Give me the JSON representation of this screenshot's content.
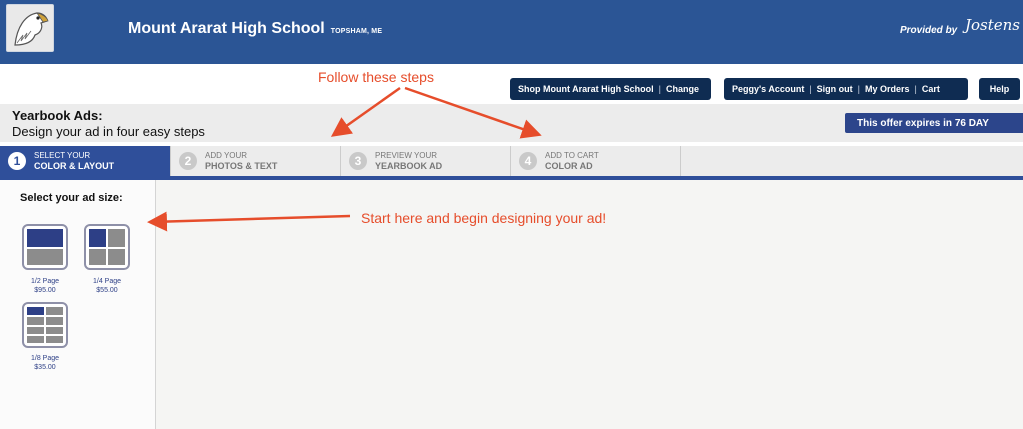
{
  "header": {
    "school_name": "Mount Ararat High School",
    "school_location": "TOPSHAM, ME",
    "provided_by": "Provided by",
    "provider_logo": "Jostens"
  },
  "topnav": {
    "shop_label": "Shop Mount Ararat High School",
    "change_label": "Change",
    "account_label": "Peggy's Account",
    "signout_label": "Sign out",
    "orders_label": "My Orders",
    "cart_label": "Cart",
    "help_label": "Help"
  },
  "annotations": {
    "follow_steps": "Follow these steps",
    "start_here": "Start here and begin designing your ad!"
  },
  "page": {
    "title": "Yearbook Ads:",
    "subtitle": "Design your ad in four easy steps",
    "offer_text": "This offer expires in",
    "offer_days": "76 DAY"
  },
  "steps": [
    {
      "num": "1",
      "line1": "SELECT YOUR",
      "line2": "COLOR & LAYOUT",
      "active": true
    },
    {
      "num": "2",
      "line1": "ADD YOUR",
      "line2": "PHOTOS & TEXT",
      "active": false
    },
    {
      "num": "3",
      "line1": "PREVIEW YOUR",
      "line2": "YEARBOOK AD",
      "active": false
    },
    {
      "num": "4",
      "line1": "ADD TO CART",
      "line2": "COLOR AD",
      "active": false
    }
  ],
  "sidebar": {
    "title": "Select your ad size:",
    "sizes": [
      {
        "name": "1/2 Page",
        "price": "$95.00"
      },
      {
        "name": "1/4 Page",
        "price": "$55.00"
      },
      {
        "name": "1/8 Page",
        "price": "$35.00"
      }
    ]
  },
  "colors": {
    "header_bg": "#2b5595",
    "nav_button_bg": "#0f2c52",
    "active_step_bg": "#2f4f9a",
    "annotation_red": "#e64d2b",
    "ad_navy": "#2d3f86",
    "ad_gray": "#8c8c8c"
  }
}
